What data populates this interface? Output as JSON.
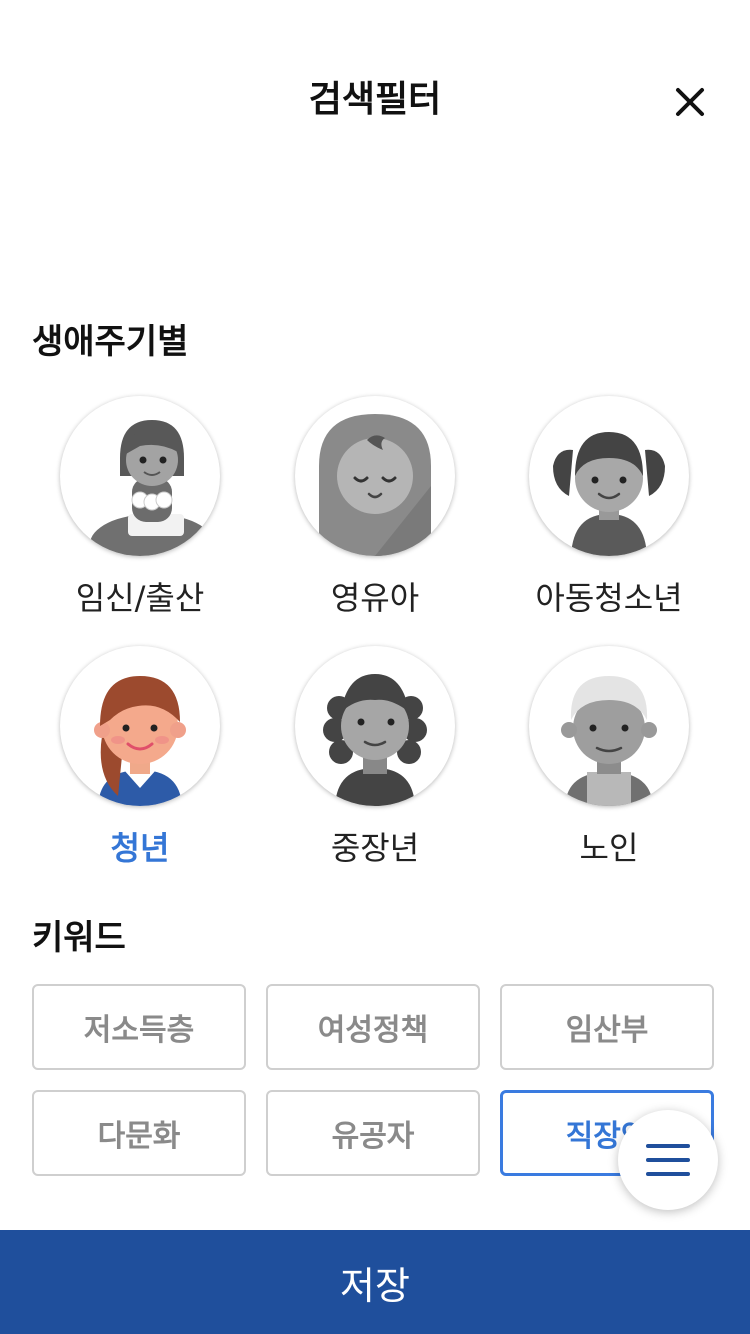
{
  "header": {
    "title": "검색필터",
    "close_icon": "close-icon"
  },
  "lifecycle": {
    "title": "생애주기별",
    "items": [
      {
        "label": "임신/출산",
        "icon": "pregnant-woman-icon",
        "selected": false
      },
      {
        "label": "영유아",
        "icon": "baby-icon",
        "selected": false
      },
      {
        "label": "아동청소년",
        "icon": "child-icon",
        "selected": false
      },
      {
        "label": "청년",
        "icon": "young-adult-icon",
        "selected": true
      },
      {
        "label": "중장년",
        "icon": "middle-aged-icon",
        "selected": false
      },
      {
        "label": "노인",
        "icon": "elderly-icon",
        "selected": false
      }
    ]
  },
  "keywords": {
    "title": "키워드",
    "items": [
      {
        "label": "저소득층",
        "selected": false
      },
      {
        "label": "여성정책",
        "selected": false
      },
      {
        "label": "임산부",
        "selected": false
      },
      {
        "label": "다문화",
        "selected": false
      },
      {
        "label": "유공자",
        "selected": false
      },
      {
        "label": "직장인",
        "selected": true
      }
    ]
  },
  "fab": {
    "icon": "menu-icon"
  },
  "footer": {
    "save_label": "저장"
  },
  "colors": {
    "accent": "#3476d6",
    "save_bar": "#1f4f9c",
    "inactive_text": "#8a8a8a",
    "border": "#cfcfcf"
  }
}
